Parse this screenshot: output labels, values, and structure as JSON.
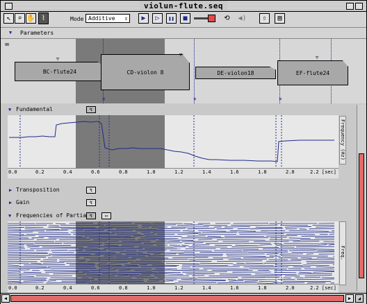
{
  "window": {
    "title": "violun-flute.seq"
  },
  "toolbar": {
    "tools": [
      {
        "name": "arrow-tool-icon",
        "glyph": "↖"
      },
      {
        "name": "zoom-tool-icon",
        "glyph": "⌕"
      },
      {
        "name": "hand-tool-icon",
        "glyph": "✋"
      },
      {
        "name": "scrub-tool-icon",
        "glyph": "⌇"
      }
    ],
    "mode_label": "Mode",
    "mode_value": "Additive",
    "transport": [
      {
        "name": "play-button",
        "glyph": "▶"
      },
      {
        "name": "play-selection-button",
        "glyph": "▷"
      },
      {
        "name": "pause-button",
        "glyph": "❚❚"
      },
      {
        "name": "stop-button",
        "glyph": "■"
      }
    ],
    "volume_level": 0.8,
    "right_icons": [
      {
        "name": "speaker-icon",
        "glyph": "🔈"
      },
      {
        "name": "export-icon",
        "glyph": "⇧"
      },
      {
        "name": "info-icon",
        "glyph": "🗎"
      }
    ]
  },
  "parameters": {
    "label": "Parameters"
  },
  "sounds": [
    {
      "label": "BC-flute24"
    },
    {
      "label": "CD-violon 8"
    },
    {
      "label": "DE-violon18"
    },
    {
      "label": "EF-flute24"
    }
  ],
  "sections": {
    "fundamental": "Fundamental",
    "transposition": "Transposition",
    "gain": "Gain",
    "frequencies": "Frequencies of Partials"
  },
  "vertical_labels": {
    "fundamental": "Frequency (Hz)",
    "partials": "Freq."
  },
  "time_axis": {
    "ticks": [
      "0.0",
      "0.2",
      "0.4",
      "0.6",
      "0.8",
      "1.0",
      "1.2",
      "1.4",
      "1.6",
      "1.8",
      "2.0",
      "2.2 [sec]"
    ]
  },
  "colors": {
    "trace": "#1d2a8a",
    "selection": "#7a7a7a",
    "scroll_accent": "#e06a6a"
  }
}
